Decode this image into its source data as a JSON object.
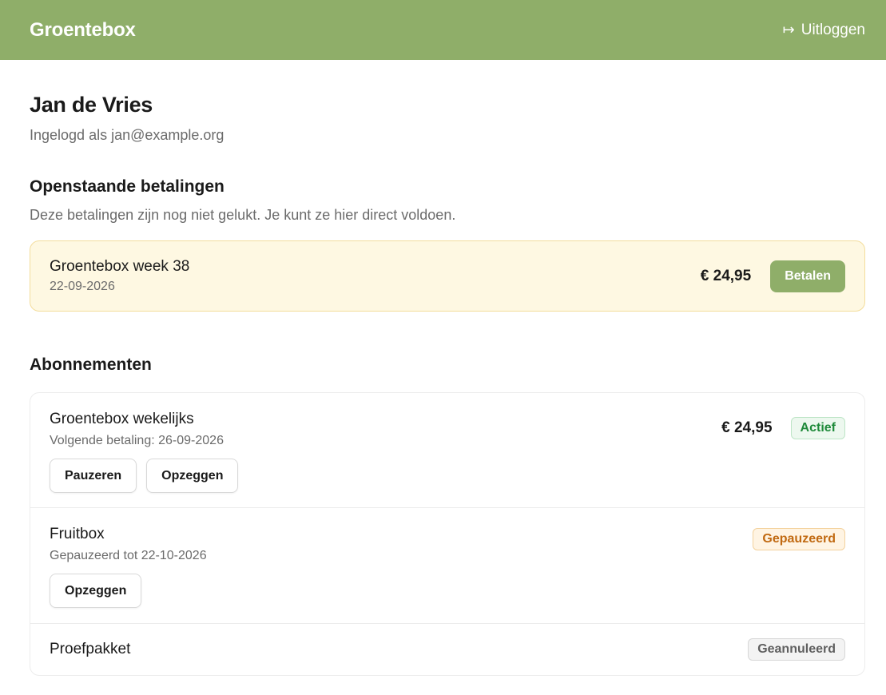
{
  "header": {
    "brand": "Groentebox",
    "logout_icon": "↦",
    "logout_label": "Uitloggen",
    "background_color": "#8fae69"
  },
  "user": {
    "name": "Jan de Vries",
    "logged_in_as": "Ingelogd als jan@example.org"
  },
  "payments": {
    "title": "Openstaande betalingen",
    "description": "Deze betalingen zijn nog niet gelukt. Je kunt ze hier direct voldoen.",
    "items": [
      {
        "title": "Groentebox week 38",
        "date": "22-09-2026",
        "amount": "€ 24,95",
        "pay_label": "Betalen"
      }
    ]
  },
  "subscriptions": {
    "title": "Abonnementen",
    "items": [
      {
        "title": "Groentebox wekelijks",
        "meta": "Volgende betaling: 26-09-2026",
        "amount": "€ 24,95",
        "status": "Actief",
        "actions": [
          "Pauzeren",
          "Opzeggen"
        ]
      },
      {
        "title": "Fruitbox",
        "meta": "Gepauzeerd tot 22-10-2026",
        "status": "Gepauzeerd",
        "actions": [
          "Opzeggen"
        ]
      },
      {
        "title": "Proefpakket",
        "status": "Geannuleerd"
      }
    ]
  },
  "colors": {
    "accent": "#8fae69",
    "payment_bg": "#fef8e2",
    "status_active": "#1f8a3a",
    "status_paused": "#c16a12",
    "status_cancelled": "#5f5f5f"
  }
}
